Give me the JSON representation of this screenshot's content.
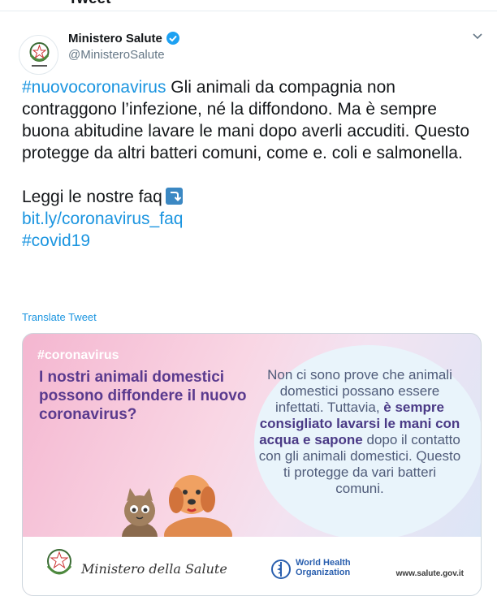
{
  "header": {
    "title": "Tweet"
  },
  "tweet": {
    "author_name": "Ministero Salute",
    "handle": "@MinisteroSalute",
    "verified": true,
    "text_hashtag": "#nuovocoronavirus",
    "text_main": " Gli animali da compagnia non contraggono l’infezione, né la diffondono. Ma è sempre buona abitudine lavare le mani dopo averli accuditi. Questo protegge da altri batteri comuni, come e. coli e salmonella.",
    "faq_label": "Leggi le nostre faq",
    "faq_link": "bit.ly/coronavirus_faq",
    "hashtag2": "#covid19",
    "translate_label": "Translate Tweet"
  },
  "card": {
    "hashtag": "#coronavirus",
    "question": "I nostri animali domestici possono diffondere il nuovo coronavirus?",
    "bubble_part1": "Non ci sono prove che animali domestici possano essere infettati. Tuttavia, ",
    "bubble_bold": "è sempre consigliato lavarsi le mani con acqua e sapone",
    "bubble_part2": " dopo il contatto con gli animali domestici. Questo ti protegge da vari batteri comuni.",
    "ministero_label": "Ministero della Salute",
    "who_line1": "World Health",
    "who_line2": "Organization",
    "site": "www.salute.gov.it"
  },
  "colors": {
    "link": "#1b95e0",
    "purple": "#5a3a8e",
    "pink": "#f4b6d0"
  }
}
